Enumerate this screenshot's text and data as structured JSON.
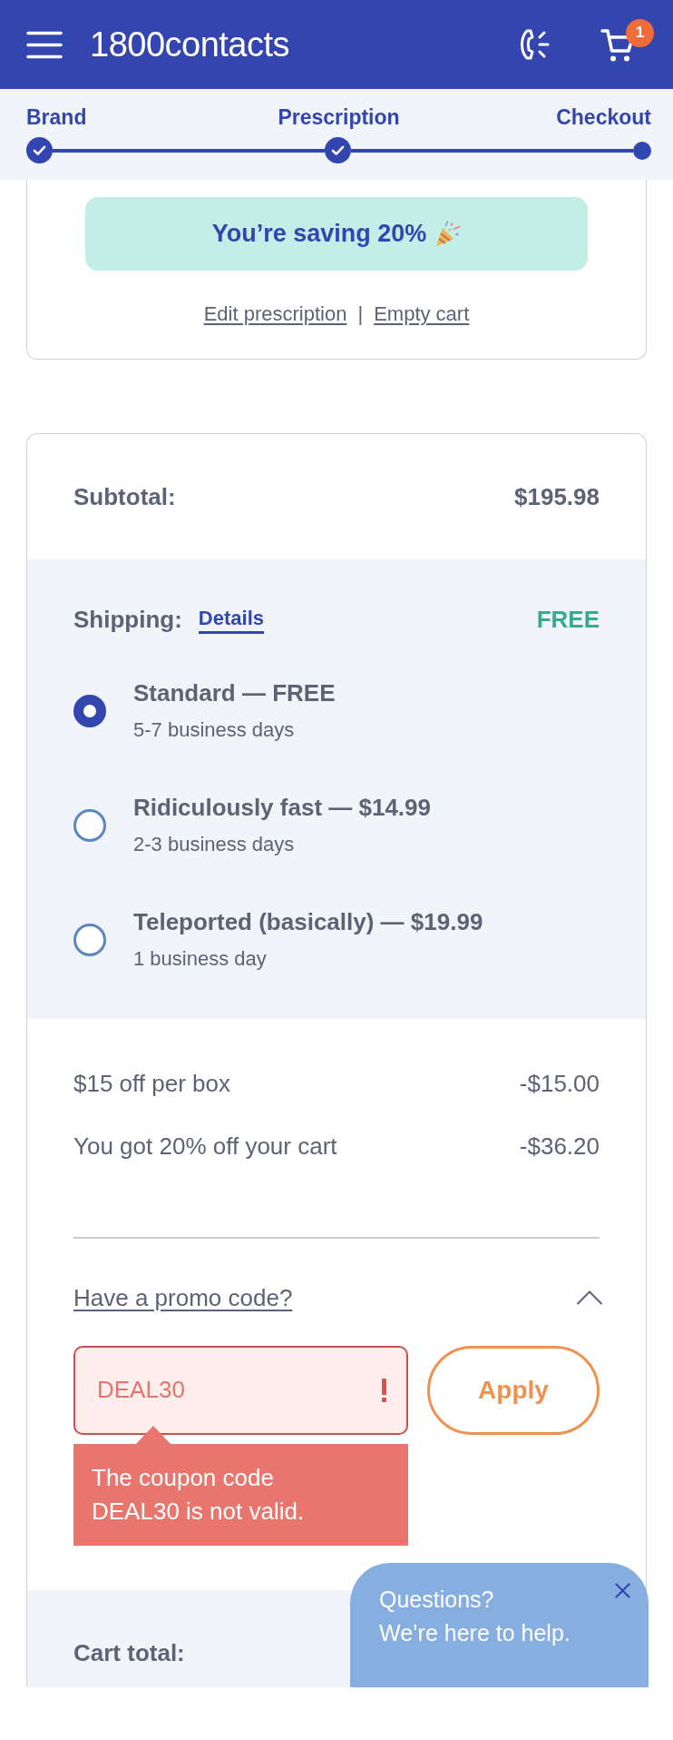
{
  "header": {
    "logo": "1800contacts",
    "cart_count": "1"
  },
  "progress": {
    "steps": [
      {
        "label": "Brand",
        "completed": true
      },
      {
        "label": "Prescription",
        "completed": true
      },
      {
        "label": "Checkout",
        "completed": false
      }
    ]
  },
  "cart_card": {
    "banner": "You’re saving 20%",
    "links": [
      "Edit prescription",
      "Empty cart"
    ],
    "separator": "|"
  },
  "summary": {
    "subtotal": {
      "label": "Subtotal:",
      "value": "$195.98"
    },
    "shipping": {
      "label": "Shipping:",
      "details_link": "Details",
      "value": "FREE",
      "options": [
        {
          "title": "Standard — FREE",
          "subtitle": "5-7 business days",
          "selected": true
        },
        {
          "title": "Ridiculously fast — $14.99",
          "subtitle": "2-3 business days",
          "selected": false
        },
        {
          "title": "Teleported (basically) — $19.99",
          "subtitle": "1 business day",
          "selected": false
        }
      ]
    },
    "discounts": [
      {
        "label": "$15 off per box",
        "value": "-$15.00"
      },
      {
        "label": "You got 20% off your cart",
        "value": "-$36.20"
      }
    ],
    "promo": {
      "toggle": "Have a promo code?",
      "expanded": true,
      "value": "DEAL30",
      "error": "The coupon code DEAL30 is not valid.",
      "button": "Apply"
    },
    "cart_total": {
      "label": "Cart total:"
    }
  },
  "chat": {
    "title": "Questions?",
    "message": "We’re here to help."
  }
}
